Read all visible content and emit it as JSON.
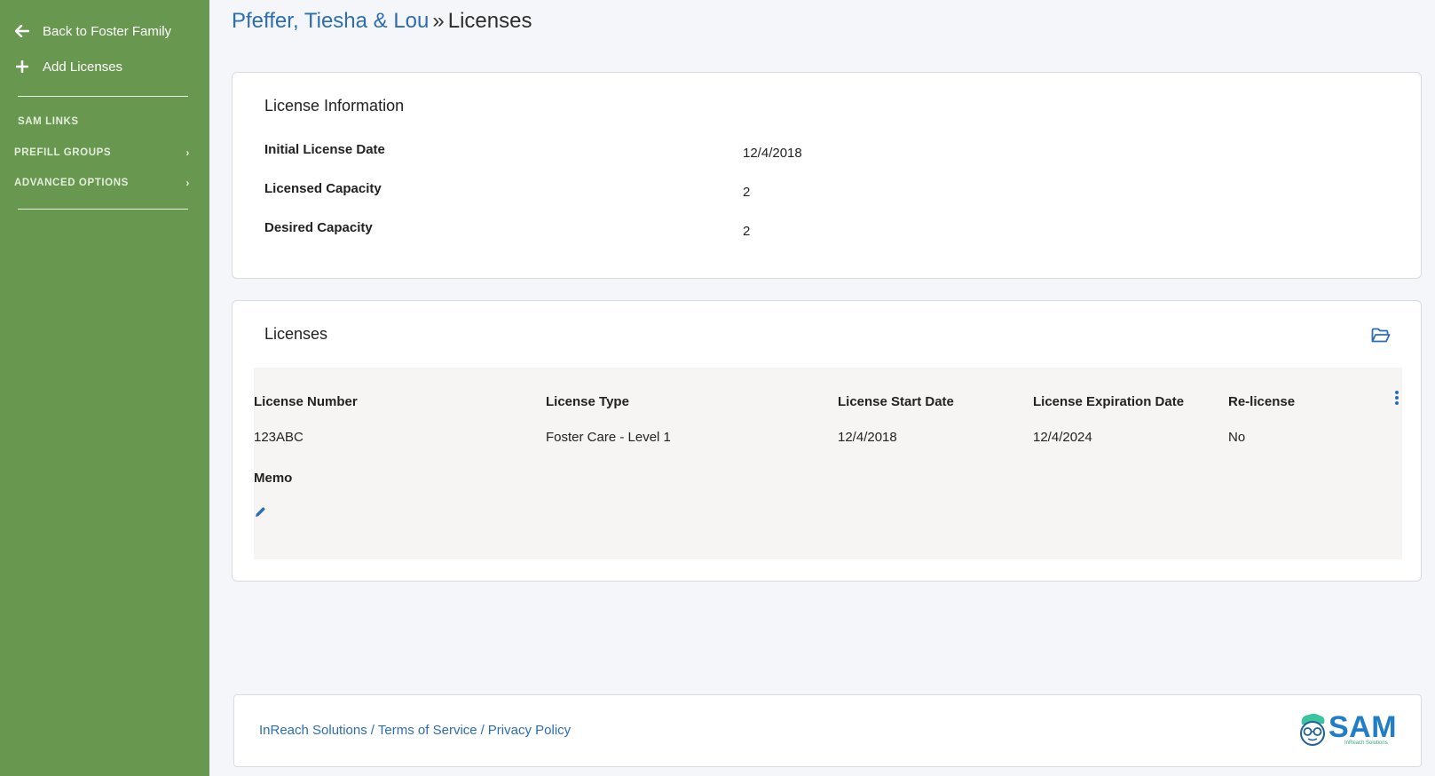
{
  "sidebar": {
    "back_label": "Back to Foster Family",
    "add_label": "Add Licenses",
    "sections": {
      "sam_links": "SAM LINKS",
      "prefill_groups": "PREFILL GROUPS",
      "advanced_options": "ADVANCED OPTIONS"
    }
  },
  "header": {
    "crumb": "Pfeffer, Tiesha & Lou",
    "separator": "»",
    "current": "Licenses"
  },
  "license_info": {
    "heading": "License Information",
    "rows": [
      {
        "label": "Initial License Date",
        "value": "12/4/2018"
      },
      {
        "label": "Licensed Capacity",
        "value": "2"
      },
      {
        "label": "Desired Capacity",
        "value": "2"
      }
    ]
  },
  "licenses": {
    "heading": "Licenses",
    "columns": [
      "License Number",
      "License Type",
      "License Start Date",
      "License Expiration Date",
      "Re-license"
    ],
    "rows": [
      {
        "number": "123ABC",
        "type": "Foster Care - Level 1",
        "start": "12/4/2018",
        "expiration": "12/4/2024",
        "relicense": "No"
      }
    ],
    "memo_label": "Memo"
  },
  "footer": {
    "links": [
      "InReach Solutions",
      "Terms of Service",
      "Privacy Policy"
    ],
    "separator": "/",
    "logo_text": "SAM",
    "logo_sub": "InReach Solutions"
  },
  "colors": {
    "sidebar": "#68984f",
    "link": "#2c6db4",
    "logo": "#1f7ec6"
  }
}
